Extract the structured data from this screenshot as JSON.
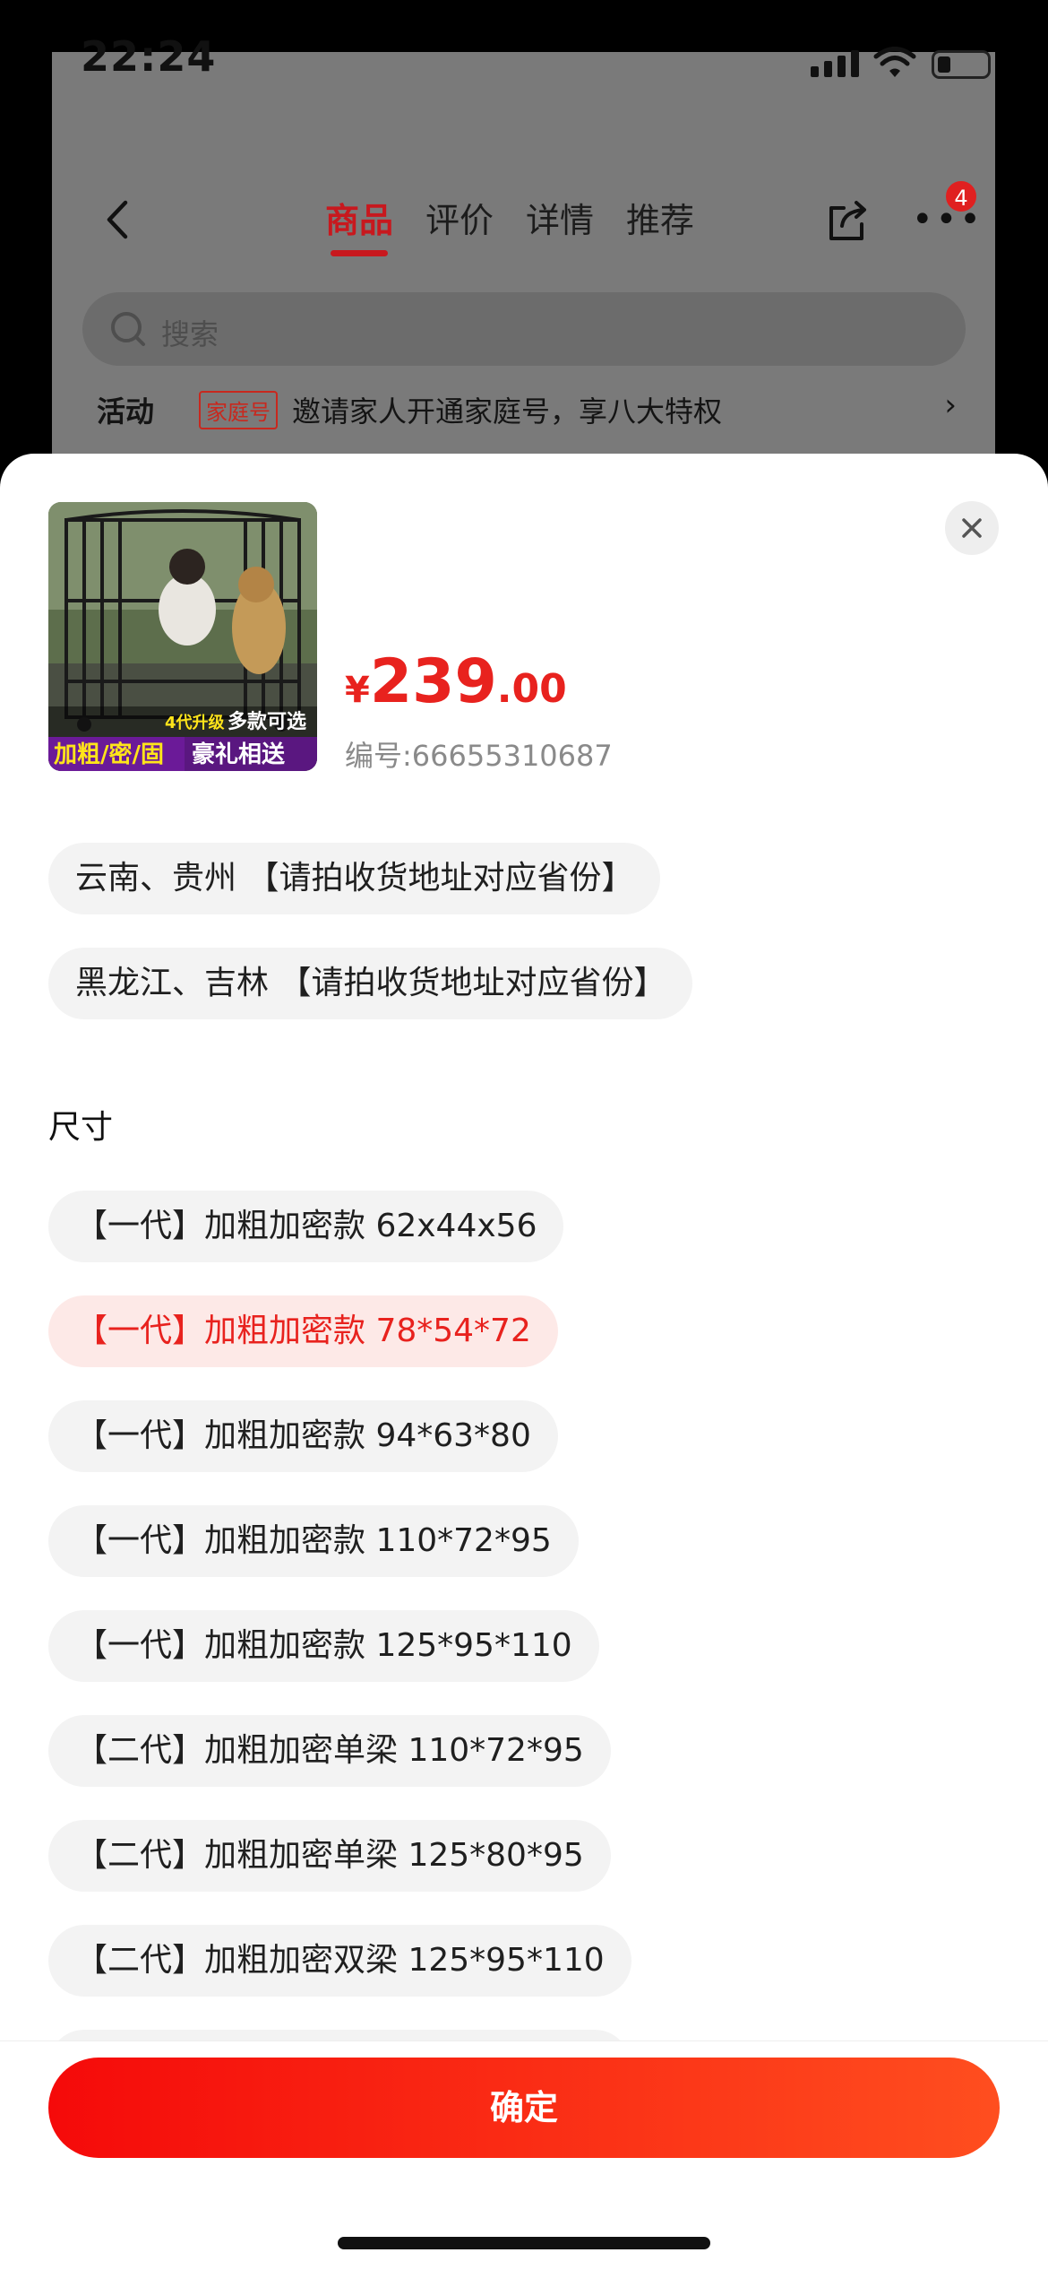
{
  "status_bar": {
    "time": "22:24"
  },
  "header": {
    "tabs": [
      {
        "label": "商品",
        "active": true
      },
      {
        "label": "评价",
        "active": false
      },
      {
        "label": "详情",
        "active": false
      },
      {
        "label": "推荐",
        "active": false
      }
    ],
    "more_badge": "4"
  },
  "search": {
    "placeholder": "搜索"
  },
  "activity": {
    "label": "活动",
    "tag": "家庭号",
    "text": "邀请家人开通家庭号，享八大特权",
    "arrow": "›"
  },
  "sheet": {
    "thumbnail": {
      "badge_top": "4代升级",
      "badge_top2": "多款可选",
      "banner_left": "加粗/密/固",
      "banner_right": "豪礼相送"
    },
    "price": {
      "currency": "¥",
      "integer": "239",
      "decimal": ".00"
    },
    "sku": "编号:66655310687",
    "regions": [
      "云南、贵州 【请拍收货地址对应省份】",
      "黑龙江、吉林 【请拍收货地址对应省份】"
    ],
    "size_label": "尺寸",
    "sizes": [
      {
        "label": "【一代】加粗加密款 62x44x56",
        "selected": false
      },
      {
        "label": "【一代】加粗加密款 78*54*72",
        "selected": true
      },
      {
        "label": "【一代】加粗加密款 94*63*80",
        "selected": false
      },
      {
        "label": "【一代】加粗加密款 110*72*95",
        "selected": false
      },
      {
        "label": "【一代】加粗加密款 125*95*110",
        "selected": false
      },
      {
        "label": "【二代】加粗加密单梁 110*72*95",
        "selected": false
      },
      {
        "label": "【二代】加粗加密单梁 125*80*95",
        "selected": false
      },
      {
        "label": "【二代】加粗加密双梁 125*95*110",
        "selected": false
      }
    ],
    "confirm_label": "确定"
  },
  "colors": {
    "accent": "#e8221e",
    "selected_bg": "#fde9e7",
    "chip_bg": "#f3f3f3"
  }
}
